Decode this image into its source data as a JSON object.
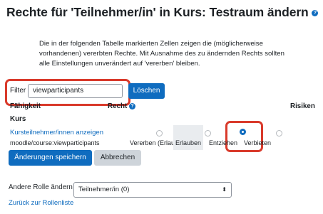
{
  "page": {
    "title": "Rechte für 'Teilnehmer/in' in Kurs: Testraum ändern",
    "description": "Die in der folgenden Tabelle markierten Zellen zeigen die (möglicherweise vorhandenen) vererbten Rechte. Mit Ausnahme des zu ändernden Rechts sollten alle Einstellungen unverändert auf 'vererben' bleiben."
  },
  "filter": {
    "label": "Filter",
    "value": "viewparticipants",
    "clear_label": "Löschen"
  },
  "table": {
    "col_capability": "Fähigkeit",
    "col_permission": "Recht",
    "col_risks": "Risiken",
    "context": "Kurs",
    "row": {
      "name": "Kursteilnehmer/innen anzeigen",
      "capability": "moodle/course:viewparticipants",
      "options": [
        "Vererben (Erlauben)",
        "Erlauben",
        "Entziehen",
        "Verbieten"
      ],
      "selected": "Entziehen"
    }
  },
  "actions": {
    "save_label": "Änderungen speichern",
    "cancel_label": "Abbrechen"
  },
  "other_role": {
    "label": "Andere Rolle ändern",
    "selected": "Teilnehmer/in (0)"
  },
  "back_link": "Zurück zur Rollenliste",
  "icons": {
    "help": "help-icon",
    "dropdown": "chevron-down-icon"
  },
  "colors": {
    "accent": "#0f6cbf",
    "highlight": "#d93a2b"
  }
}
